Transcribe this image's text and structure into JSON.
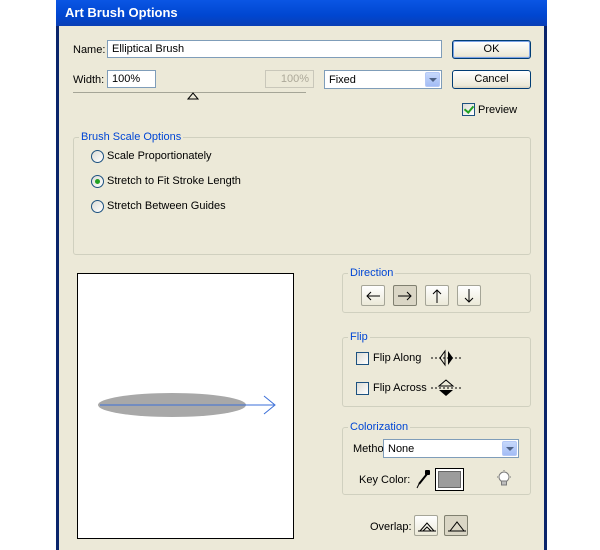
{
  "window": {
    "title": "Art Brush Options"
  },
  "name": {
    "label": "Name:",
    "value": "Elliptical Brush"
  },
  "width": {
    "label": "Width:",
    "value": "100%",
    "variation": "100%",
    "mode": "Fixed"
  },
  "buttons": {
    "ok": "OK",
    "cancel": "Cancel"
  },
  "preview_checkbox": {
    "label": "Preview",
    "checked": true
  },
  "brush_scale": {
    "title": "Brush Scale Options",
    "options": [
      {
        "label": "Scale Proportionately",
        "selected": false
      },
      {
        "label": "Stretch to Fit Stroke Length",
        "selected": true
      },
      {
        "label": "Stretch Between Guides",
        "selected": false
      }
    ]
  },
  "direction": {
    "title": "Direction",
    "selected": "right"
  },
  "flip": {
    "title": "Flip",
    "along": "Flip Along",
    "across": "Flip Across"
  },
  "colorization": {
    "title": "Colorization",
    "method_label": "Method:",
    "method_value": "None",
    "key_color_label": "Key Color:",
    "key_color": "#9c9c9c"
  },
  "overlap": {
    "label": "Overlap:"
  },
  "colors": {
    "title_bar": "#0046d0",
    "face": "#ece9d8",
    "group_title": "#0046d5",
    "brush_fill": "#a8a8a8",
    "brush_stroke": "#3b6fd8"
  }
}
